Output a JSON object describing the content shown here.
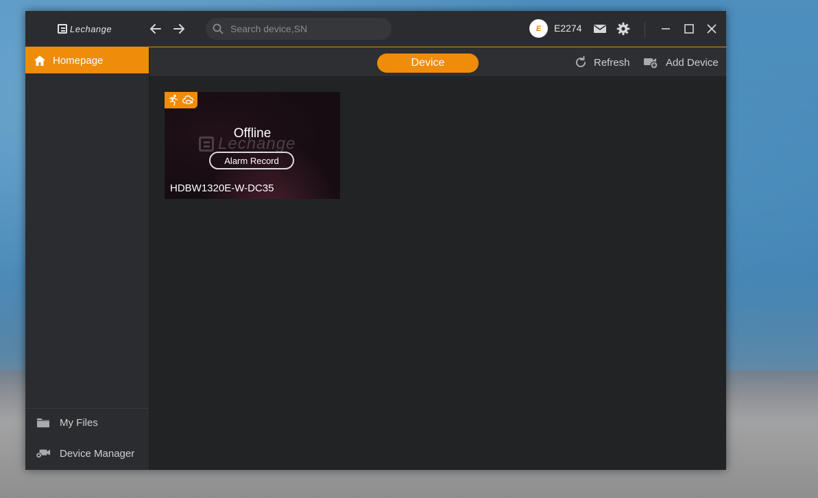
{
  "titlebar": {
    "logo_text": "Lechange",
    "search_placeholder": "Search device,SN",
    "avatar_letter": "E",
    "username": "E2274"
  },
  "sidebar": {
    "home_label": "Homepage",
    "bottom_items": [
      {
        "label": "My Files",
        "icon": "folder-icon"
      },
      {
        "label": "Device Manager",
        "icon": "device-manager-icon"
      }
    ]
  },
  "toolbar": {
    "active_tab": "Device",
    "refresh_label": "Refresh",
    "add_device_label": "Add Device"
  },
  "devices": [
    {
      "name": "HDBW1320E-W-DC35",
      "status": "Offline",
      "action_label": "Alarm Record",
      "watermark": "Lechange",
      "badges": [
        "motion-detect-icon",
        "cloud-record-icon"
      ]
    }
  ],
  "colors": {
    "accent": "#ef8c0a",
    "titlebar_bg": "#2b2c2f",
    "content_bg": "#222325"
  }
}
